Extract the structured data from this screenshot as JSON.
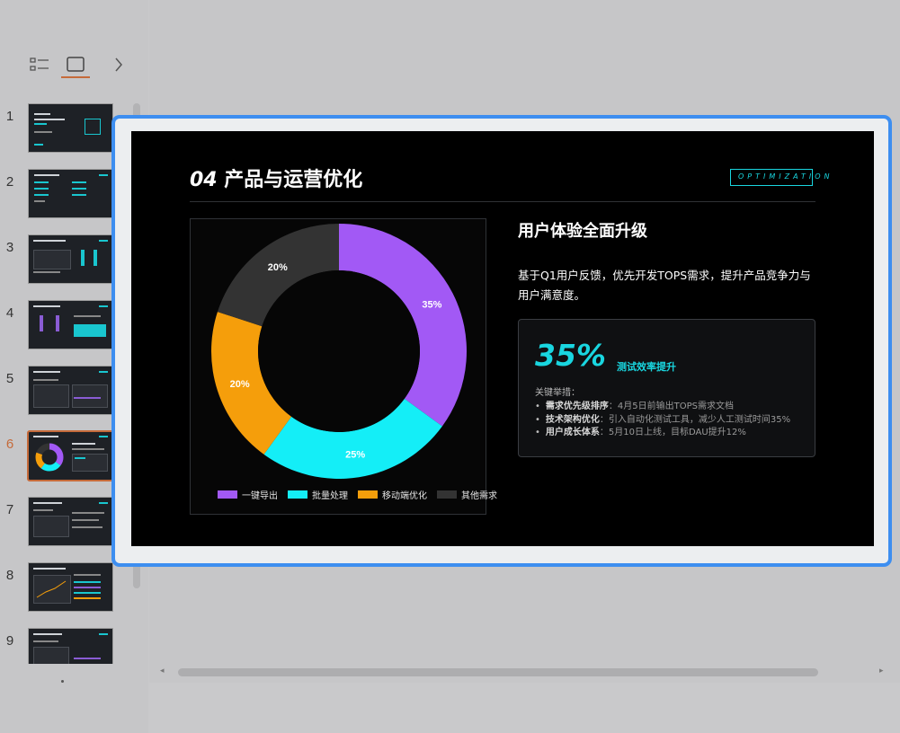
{
  "toolbar": {
    "outline_icon": "outline-list-icon",
    "slide_icon": "slide-view-icon",
    "expand_icon": "chevron-right-icon"
  },
  "thumbnails": [
    {
      "number": "1",
      "active": false
    },
    {
      "number": "2",
      "active": false
    },
    {
      "number": "3",
      "active": false
    },
    {
      "number": "4",
      "active": false
    },
    {
      "number": "5",
      "active": false
    },
    {
      "number": "6",
      "active": true
    },
    {
      "number": "7",
      "active": false
    },
    {
      "number": "8",
      "active": false
    },
    {
      "number": "9",
      "active": false
    }
  ],
  "slide": {
    "title_num": "04",
    "title_text": "产品与运营优化",
    "tag": "OPTIMIZATION",
    "subtitle": "用户体验全面升级",
    "description": "基于Q1用户反馈，优先开发TOPS需求，提升产品竞争力与用户满意度。",
    "metric": {
      "value": "35%",
      "label": "测试效率提升"
    },
    "measures_heading": "关键举措：",
    "measures": [
      {
        "name": "需求优先级排序",
        "text": "：4月5日前输出TOPS需求文档"
      },
      {
        "name": "技术架构优化",
        "text": "：引入自动化测试工具，减少人工测试时间35%"
      },
      {
        "name": "用户成长体系",
        "text": "：5月10日上线，目标DAU提升12%"
      }
    ]
  },
  "chart_data": {
    "type": "pie",
    "variant": "donut",
    "series": [
      {
        "name": "一键导出",
        "value": 35,
        "label": "35%",
        "color": "#a259f5"
      },
      {
        "name": "批量处理",
        "value": 25,
        "label": "25%",
        "color": "#14eef7"
      },
      {
        "name": "移动端优化",
        "value": 20,
        "label": "20%",
        "color": "#f59e0b"
      },
      {
        "name": "其他需求",
        "value": 20,
        "label": "20%",
        "color": "#333333"
      }
    ],
    "legend_position": "bottom"
  },
  "colors": {
    "accent": "#19d6e0",
    "selection": "#3d8ef0",
    "active_thumb": "#c56a3a"
  },
  "scroll": {
    "left_arrow": "◂",
    "right_arrow": "▸"
  }
}
